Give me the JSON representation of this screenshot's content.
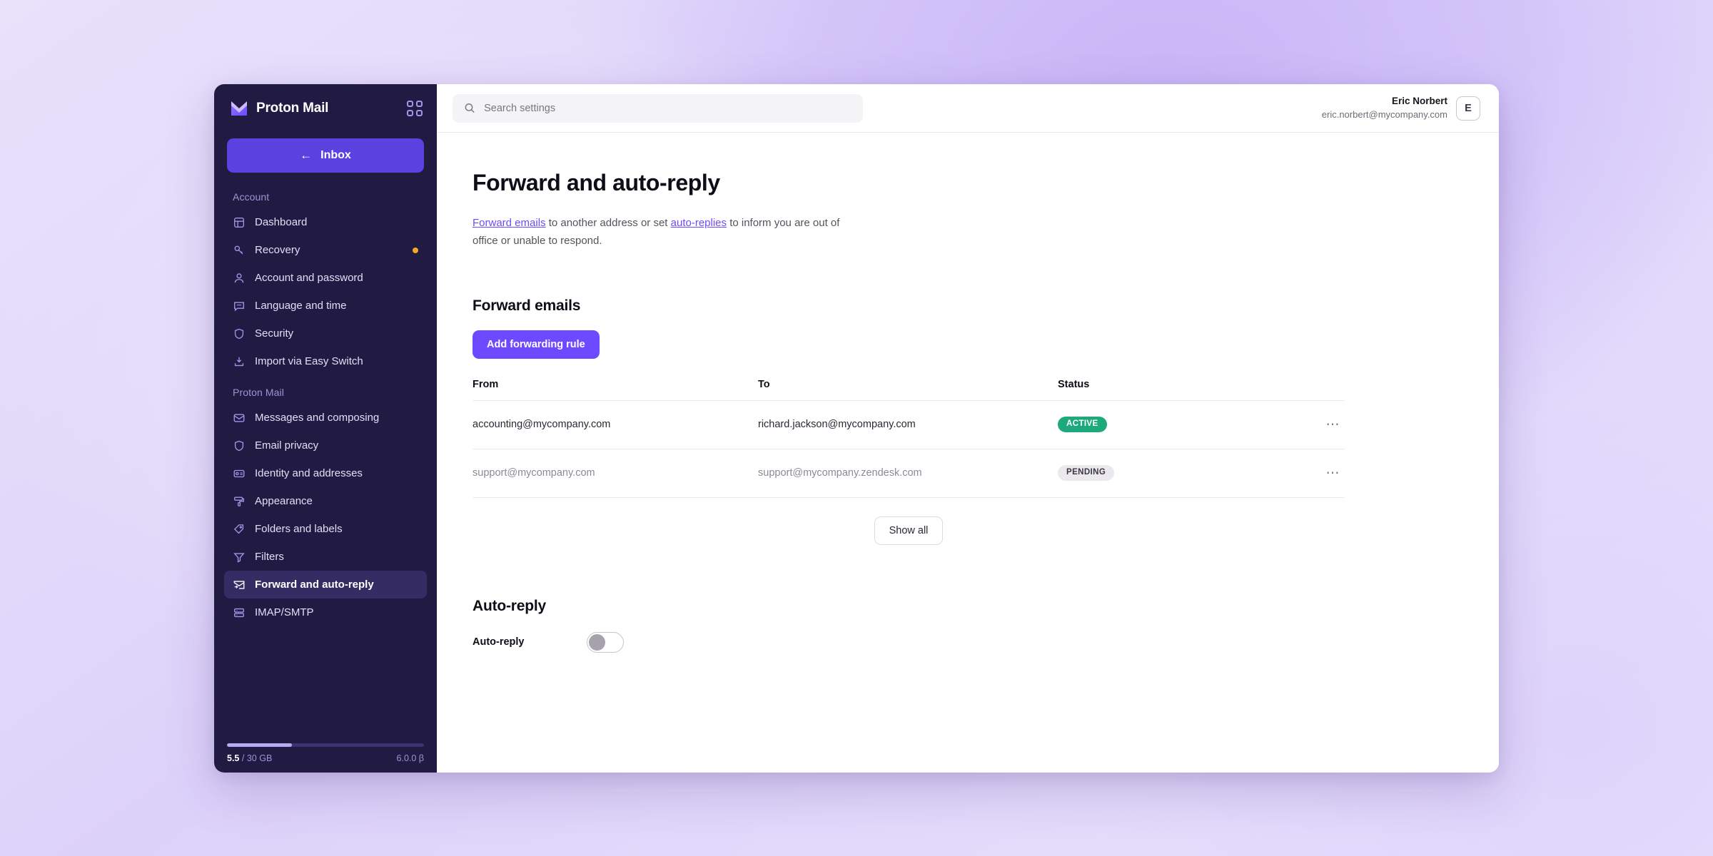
{
  "brand": {
    "name": "Proton Mail",
    "logo_icon": "proton-mail-logo",
    "apps_icon": "apps-grid-icon"
  },
  "sidebar": {
    "inbox_button": {
      "label": "Inbox",
      "icon": "arrow-left-icon"
    },
    "sections": [
      {
        "label": "Account",
        "items": [
          {
            "label": "Dashboard",
            "icon": "dashboard-icon",
            "active": false,
            "dot": false
          },
          {
            "label": "Recovery",
            "icon": "key-icon",
            "active": false,
            "dot": true
          },
          {
            "label": "Account and password",
            "icon": "user-icon",
            "active": false,
            "dot": false
          },
          {
            "label": "Language and time",
            "icon": "language-icon",
            "active": false,
            "dot": false
          },
          {
            "label": "Security",
            "icon": "shield-icon",
            "active": false,
            "dot": false
          },
          {
            "label": "Import via Easy Switch",
            "icon": "import-icon",
            "active": false,
            "dot": false
          }
        ]
      },
      {
        "label": "Proton Mail",
        "items": [
          {
            "label": "Messages and composing",
            "icon": "envelope-icon",
            "active": false,
            "dot": false
          },
          {
            "label": "Email privacy",
            "icon": "shield-icon",
            "active": false,
            "dot": false
          },
          {
            "label": "Identity and addresses",
            "icon": "id-card-icon",
            "active": false,
            "dot": false
          },
          {
            "label": "Appearance",
            "icon": "paint-roller-icon",
            "active": false,
            "dot": false
          },
          {
            "label": "Folders and labels",
            "icon": "tag-icon",
            "active": false,
            "dot": false
          },
          {
            "label": "Filters",
            "icon": "filter-icon",
            "active": false,
            "dot": false
          },
          {
            "label": "Forward and auto-reply",
            "icon": "forward-envelope-icon",
            "active": true,
            "dot": false
          },
          {
            "label": "IMAP/SMTP",
            "icon": "server-icon",
            "active": false,
            "dot": false
          }
        ]
      }
    ],
    "storage": {
      "used": "5.5",
      "separator": "/",
      "total": "30 GB",
      "percent": 33,
      "version": "6.0.0 β"
    }
  },
  "topbar": {
    "search": {
      "placeholder": "Search settings",
      "value": "",
      "icon": "search-icon"
    },
    "user": {
      "name": "Eric Norbert",
      "email": "eric.norbert@mycompany.com",
      "avatar_initial": "E"
    }
  },
  "page": {
    "title": "Forward and auto-reply",
    "description": {
      "link1": "Forward emails",
      "text1": " to another address or set ",
      "link2": "auto-replies",
      "text2": " to inform you are out of office or unable to respond."
    }
  },
  "forward_emails": {
    "section_title": "Forward emails",
    "add_button": "Add forwarding rule",
    "columns": [
      "From",
      "To",
      "Status"
    ],
    "rows": [
      {
        "from": "accounting@mycompany.com",
        "to": "richard.jackson@mycompany.com",
        "status": "ACTIVE",
        "status_kind": "active",
        "menu_icon": "ellipsis-icon"
      },
      {
        "from": "support@mycompany.com",
        "to": "support@mycompany.zendesk.com",
        "status": "PENDING",
        "status_kind": "pending",
        "menu_icon": "ellipsis-icon"
      }
    ],
    "show_all_button": "Show all"
  },
  "auto_reply": {
    "section_title": "Auto-reply",
    "toggle_label": "Auto-reply",
    "toggle_on": false
  },
  "colors": {
    "brand_purple": "#6d4aff",
    "inbox_purple": "#5b41e0",
    "sidebar_bg": "#211b43",
    "active_nav_bg": "#352c63",
    "badge_active": "#1ea97c",
    "badge_pending": "#ebe9ee",
    "notification_dot": "#f5a623"
  }
}
